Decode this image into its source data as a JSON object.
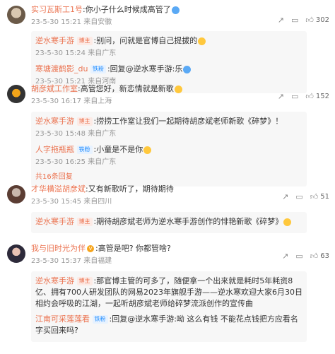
{
  "comments": [
    {
      "user": "实习瓦斯工1号",
      "text": ":你小子什么时候成高管了",
      "actions": {
        "likes": "302"
      },
      "replies": [
        {
          "user": "逆水寒手游",
          "tag": "博主",
          "text": ":别问，问就是官博自己提拔的",
          "time": "23-5-30 15:24",
          "location": "来自广东"
        },
        {
          "user": "寒塘渡鹤影_du",
          "tag": "铁粉",
          "text": ":回复@逆水寒手游:乐",
          "time": "23-5-30 15:21",
          "location": "来自河南"
        }
      ],
      "time": "23-5-30 15:21",
      "location": "来自安徽",
      "more": ""
    },
    {
      "user": "胡彦斌工作室",
      "text": ":高管您好，新恋情就是新歌",
      "actions": {
        "likes": "152"
      },
      "replies": [
        {
          "user": "逆水寒手游",
          "tag": "博主",
          "text": ":捞捞工作室让我们一起期待胡彦斌老师新歌《碎梦》！",
          "time": "23-5-30 15:48",
          "location": "来自广东"
        },
        {
          "user": "人字拖瓶瓶",
          "tag": "铁粉",
          "text": ":小童是不是你",
          "time": "23-5-30 16:25",
          "location": "来自广东"
        }
      ],
      "time": "23-5-30 16:17",
      "location": "来自上海",
      "more": "共16条回复"
    },
    {
      "user": "才华横溢胡彦斌",
      "text": ":又有新歌听了，期待期待",
      "actions": {
        "likes": "51"
      },
      "replies": [
        {
          "user": "逆水寒手游",
          "tag": "博主",
          "text": ":期待胡彦斌老师为逆水寒手游创作的悱艳新歌《碎梦》",
          "time": "",
          "location": ""
        }
      ],
      "time": "23-5-30 15:45",
      "location": "来自四川",
      "more": ""
    },
    {
      "user": "我与旧时光为伴",
      "text": ":高管是吧? 你都管啥?",
      "actions": {
        "likes": "63"
      },
      "replies": [
        {
          "user": "逆水寒手游",
          "tag": "博主",
          "text": ":那官博主管的可多了，随便拿一个出来就是耗时5年耗资8亿、拥有700人研发团队的网易2023年旗舰手游——逆水寒欢迎大家6月30日相约会呼吸的江湖，一起听胡彦斌老师给碎梦流派创作的宣传曲",
          "time": "",
          "location": ""
        },
        {
          "user": "江南可采莲莲看",
          "tag": "铁粉",
          "text": ":回复@逆水寒手游:呦 这么有钱 不能花点钱把方应看名字买回来吗?",
          "time": "",
          "location": ""
        }
      ],
      "time": "23-5-30 15:37",
      "location": "来自福建",
      "more": ""
    }
  ],
  "colors": {
    "username": "#eb7350",
    "accent": "#1e9dff",
    "meta": "#999999"
  }
}
